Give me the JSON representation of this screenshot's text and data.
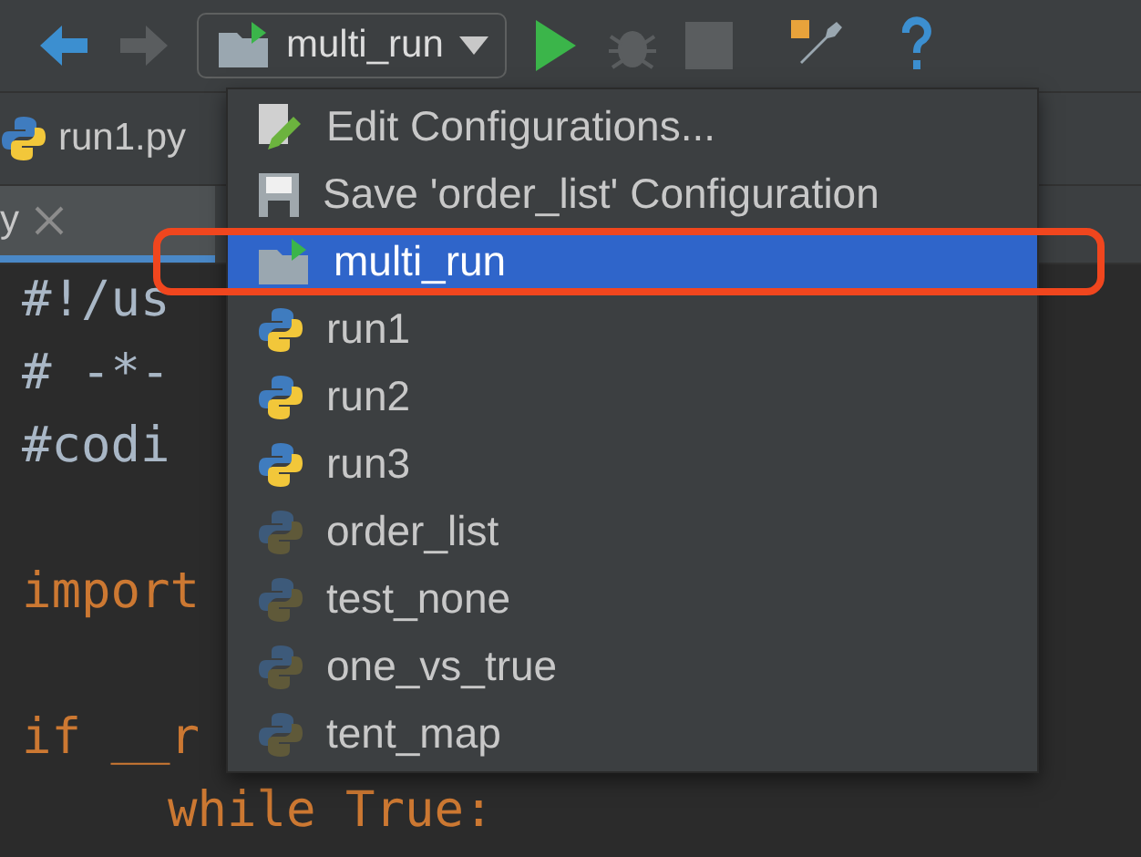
{
  "toolbar": {
    "run_config": "multi_run"
  },
  "breadcrumb": {
    "file": "run1.py"
  },
  "editor_tab": {
    "label": "y",
    "closable": true
  },
  "code_lines": [
    {
      "text": "#!/us",
      "kind": "comment"
    },
    {
      "text": "# -*-",
      "kind": "comment"
    },
    {
      "text": "#codi",
      "kind": "comment"
    },
    {
      "kind": "blank"
    },
    {
      "text": "import",
      "kind": "keyword"
    },
    {
      "kind": "blank"
    },
    {
      "text": "if __r",
      "kind": "keyword"
    },
    {
      "text": "while True:",
      "kind": "indented"
    }
  ],
  "menu": [
    {
      "label": "Edit Configurations...",
      "kind": "edit",
      "selected": false
    },
    {
      "label": "Save 'order_list' Configuration",
      "kind": "save",
      "selected": false
    },
    {
      "label": "multi_run",
      "kind": "compound",
      "selected": true
    },
    {
      "label": "run1",
      "kind": "python",
      "selected": false
    },
    {
      "label": "run2",
      "kind": "python",
      "selected": false
    },
    {
      "label": "run3",
      "kind": "python",
      "selected": false
    },
    {
      "label": "order_list",
      "kind": "temporary",
      "selected": false
    },
    {
      "label": "test_none",
      "kind": "temporary",
      "selected": false
    },
    {
      "label": "one_vs_true",
      "kind": "temporary",
      "selected": false
    },
    {
      "label": "tent_map",
      "kind": "temporary",
      "selected": false
    }
  ]
}
